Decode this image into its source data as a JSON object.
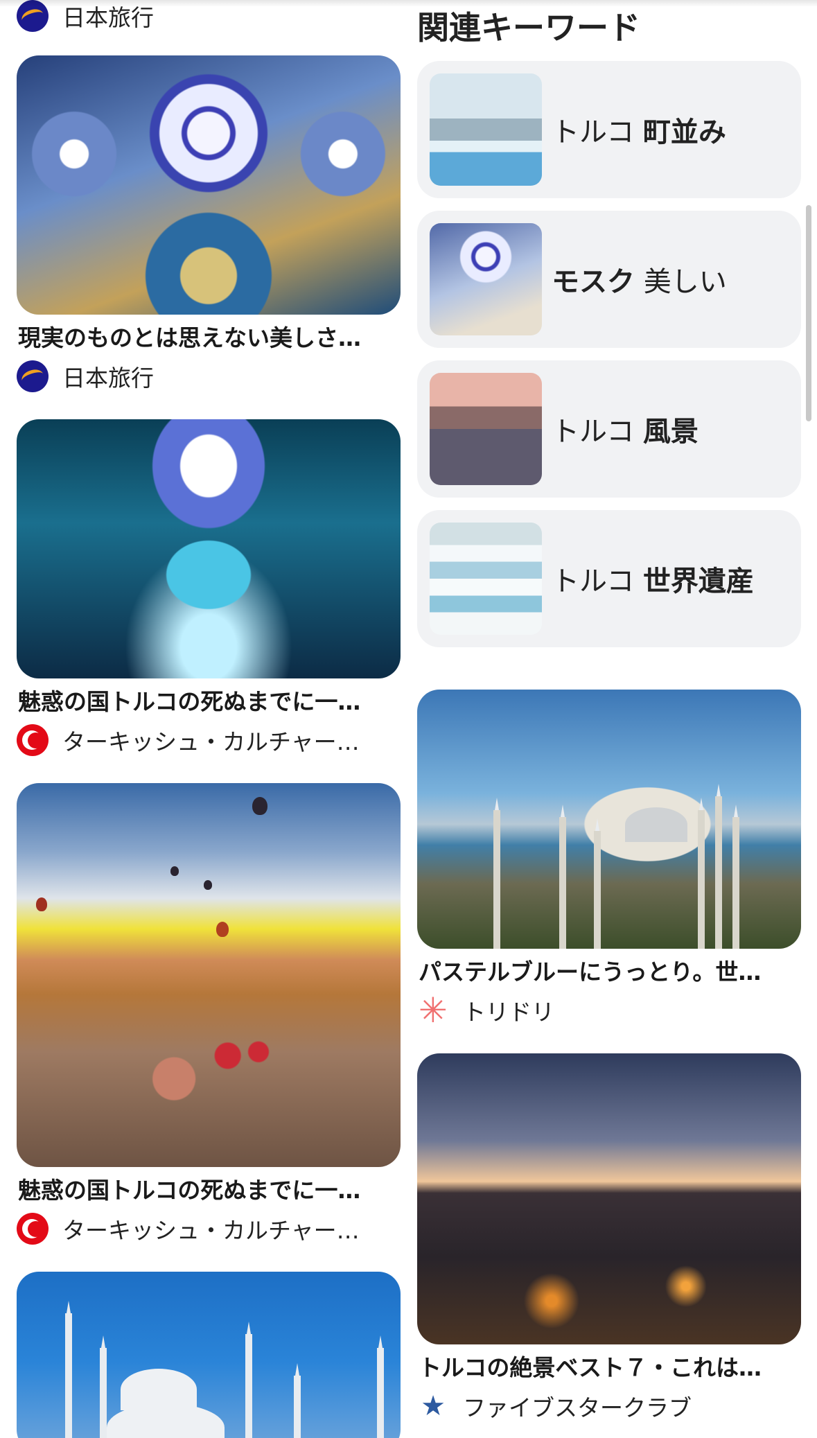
{
  "left_column": {
    "top_source": {
      "avatar_icon": "nihon-ryoko-logo-icon",
      "name": "日本旅行"
    },
    "pins": [
      {
        "title": "現実のものとは思えない美しさ…",
        "source": "日本旅行",
        "avatar_icon": "nihon-ryoko-logo-icon"
      },
      {
        "title": "魅惑の国トルコの死ぬまでに一…",
        "source": "ターキッシュ・カルチャー…",
        "avatar_icon": "turkish-flag-icon"
      },
      {
        "title": "魅惑の国トルコの死ぬまでに一…",
        "source": "ターキッシュ・カルチャー…",
        "avatar_icon": "turkish-flag-icon"
      }
    ]
  },
  "related_keywords": {
    "heading": "関連キーワード",
    "items": [
      {
        "prefix": "トルコ ",
        "bold": "町並み",
        "suffix": ""
      },
      {
        "prefix": "",
        "bold": "モスク",
        "suffix": " 美しい"
      },
      {
        "prefix": "トルコ ",
        "bold": "風景",
        "suffix": ""
      },
      {
        "prefix": "トルコ ",
        "bold": "世界遺産",
        "suffix": ""
      }
    ]
  },
  "right_column": {
    "pins": [
      {
        "title": "パステルブルーにうっとり。世…",
        "source": "トリドリ",
        "avatar_icon": "toridori-asterisk-icon"
      },
      {
        "title": "トルコの絶景ベスト７・これは…",
        "source": "ファイブスタークラブ",
        "avatar_icon": "five-star-club-icon"
      }
    ]
  },
  "colors": {
    "card_bg": "#f1f2f4",
    "text": "#1a1a1a",
    "turkish_red": "#e30a17",
    "nihon_blue": "#1c1a8e"
  }
}
